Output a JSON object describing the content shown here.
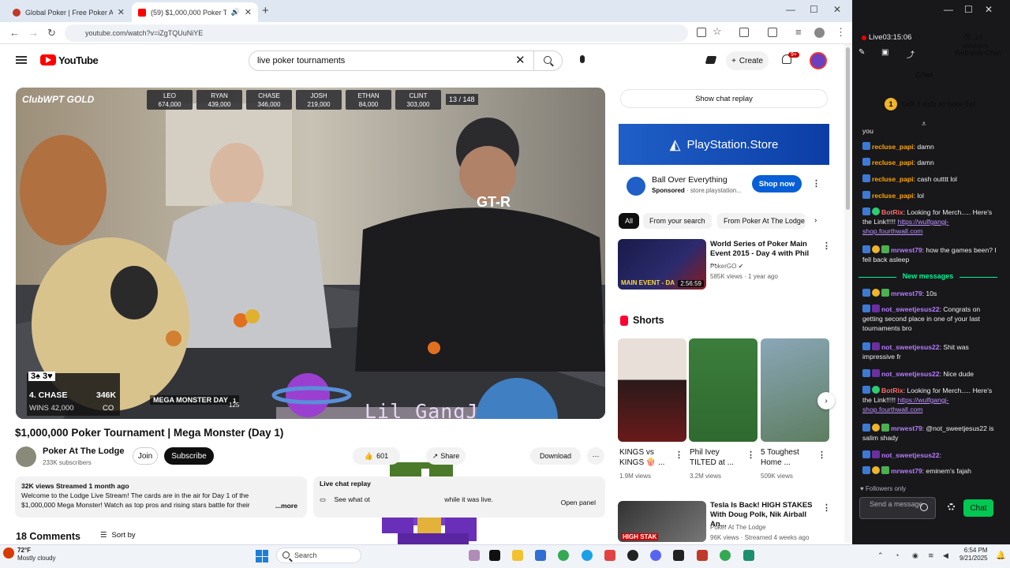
{
  "browser": {
    "tabs": [
      {
        "title": "Global Poker | Free Poker At Its",
        "active": false
      },
      {
        "title": "(59) $1,000,000 Poker Tourn",
        "active": true
      }
    ],
    "url": "youtube.com/watch?v=iZgTQUuNiYE"
  },
  "youtube": {
    "wordmark": "YouTube",
    "search_query": "live poker tournaments",
    "create_label": "Create",
    "notifications_badge": "9+"
  },
  "video": {
    "scoreboard": [
      {
        "name": "LEO",
        "chips": "674,000"
      },
      {
        "name": "RYAN",
        "chips": "439,000"
      },
      {
        "name": "CHASE",
        "chips": "346,000"
      },
      {
        "name": "JOSH",
        "chips": "219,000"
      },
      {
        "name": "ETHAN",
        "chips": "84,000"
      },
      {
        "name": "CLINT",
        "chips": "303,000"
      }
    ],
    "players_left": "13 / 148",
    "hud_player": "4. CHASE",
    "hud_chips": "346K",
    "hud_wins": "WINS 42,000",
    "hud_position": "CO",
    "hud_cards": "3♠ 3♥",
    "event_banner": "MEGA MONSTER DAY",
    "event_day": "1",
    "blind_level": "125",
    "overlay_text": "Lil GangJ",
    "logo_text": "ClubWPT GOLD",
    "jersey_text": "GT-R",
    "title": "$1,000,000 Poker Tournament | Mega Monster (Day 1)",
    "channel": "Poker At The Lodge",
    "subscribers": "233K subscribers",
    "join_label": "Join",
    "subscribe_label": "Subscribe",
    "likes": "601",
    "share_label": "Share",
    "download_label": "Download",
    "stats": "32K views  Streamed 1 month ago",
    "description": "Welcome to the Lodge Live Stream! The cards are in the air for Day 1 of the $1,000,000 Mega Monster! Watch as top pros and rising stars battle for their",
    "more_label": "...more",
    "replay_title": "Live chat replay",
    "replay_text": "See what ot",
    "replay_text_end": "while it was live.",
    "open_panel": "Open panel",
    "comments": "18 Comments",
    "sort_label": "Sort by"
  },
  "sidebar": {
    "show_chat_replay": "Show chat replay",
    "ad": {
      "banner": "PlayStation.Store",
      "title": "Ball Over Everything",
      "sponsored": "Sponsored",
      "domain": "store.playstation...",
      "cta": "Shop now"
    },
    "chips": [
      "All",
      "From your search",
      "From Poker At The Lodge"
    ],
    "rec1": {
      "title": "World Series of Poker Main Event 2015 - Day 4 with Phil ...",
      "channel": "PokerGO",
      "meta": "585K views · 1 year ago",
      "duration": "2:56:59",
      "thumb_text": "MAIN EVENT - DA"
    },
    "shorts_heading": "Shorts",
    "shorts": [
      {
        "title": "KINGS vs KINGS 🍿 ...",
        "views": "1.9M views"
      },
      {
        "title": "Phil Ivey TILTED at ...",
        "views": "3.2M views"
      },
      {
        "title": "5 Toughest Home ...",
        "views": "509K views"
      }
    ],
    "rec2": {
      "title": "Tesla Is Back! HIGH STAKES With Doug Polk, Nik Airball An...",
      "channel": "Poker At The Lodge",
      "meta": "96K views · Streamed 4 weeks ago",
      "thumb_text": "HIGH STAK"
    }
  },
  "chat": {
    "live": "Live",
    "uptime": "03:15:06",
    "viewers": "14 viewers",
    "refresh": "Refresh Chat",
    "title": "Chat",
    "gift": "Gift 1 sub to take 1st",
    "gift_count": "1",
    "new_messages": "New messages",
    "followers_only": "Followers only",
    "send_placeholder": "Send a message",
    "chat_button": "Chat",
    "lines": [
      {
        "user": "",
        "text": "you"
      },
      {
        "user": "recluse_papi",
        "text": ": damn"
      },
      {
        "user": "recluse_papi",
        "text": ": damn"
      },
      {
        "user": "recluse_papi",
        "text": ": cash outttt lol"
      },
      {
        "user": "recluse_papi",
        "text": ": lol"
      },
      {
        "user": "BotRix",
        "text": ": Looking for Merch..... Here's the Link!!!!! ",
        "link": "https://wulfgangj-shop.fourthwall.com"
      },
      {
        "user": "mrwest79",
        "text": ": how the games been? I fell back asleep"
      },
      {
        "user": "mrwest79",
        "text": ": 10s"
      },
      {
        "user": "not_sweetjesus22",
        "text": ": Congrats on getting second place in one of your last tournaments bro"
      },
      {
        "user": "not_sweetjesus22",
        "text": ": Shit was impressive fr"
      },
      {
        "user": "not_sweetjesus22",
        "text": ": Nice dude"
      },
      {
        "user": "BotRix",
        "text": ": Looking for Merch..... Here's the Link!!!!! ",
        "link": "https://wulfgangj-shop.fourthwall.com"
      },
      {
        "user": "mrwest79",
        "text": ": @not_sweetjesus22 is salim shady"
      },
      {
        "user": "not_sweetjesus22",
        "text": ":"
      },
      {
        "user": "mrwest79",
        "text": ": eminem's fajah"
      }
    ]
  },
  "taskbar": {
    "temp": "72°F",
    "weather": "Mostly cloudy",
    "search": "Search",
    "time": "6:54 PM",
    "date": "9/21/2025"
  },
  "colors": {
    "yt_red": "#ff0000",
    "chat_bg": "#18181b",
    "chat_green": "#00f593",
    "username_orange": "#ffa500",
    "username_purple": "#b67cff"
  }
}
